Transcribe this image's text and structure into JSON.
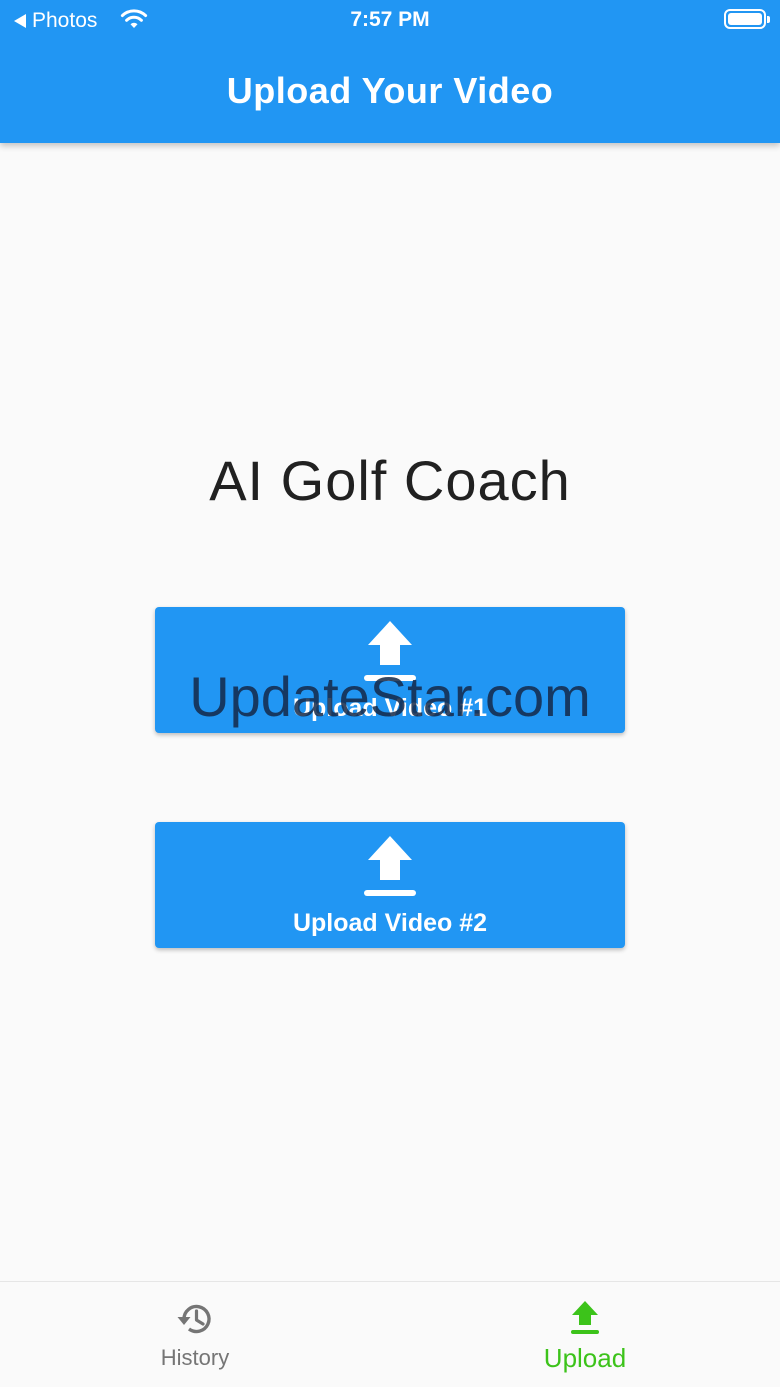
{
  "status_bar": {
    "back_app": "Photos",
    "time": "7:57 PM"
  },
  "app_bar": {
    "title": "Upload Your Video",
    "color": "#2196f3"
  },
  "main": {
    "title": "AI Golf Coach",
    "buttons": [
      {
        "label": "Upload Video #1",
        "icon": "upload-icon"
      },
      {
        "label": "Upload Video #2",
        "icon": "upload-icon"
      }
    ]
  },
  "watermark": {
    "text": "UpdateStar.com"
  },
  "bottom_nav": {
    "items": [
      {
        "label": "History",
        "icon": "history-icon",
        "active": false
      },
      {
        "label": "Upload",
        "icon": "upload-icon",
        "active": true,
        "active_color": "#3cc31a"
      }
    ]
  }
}
